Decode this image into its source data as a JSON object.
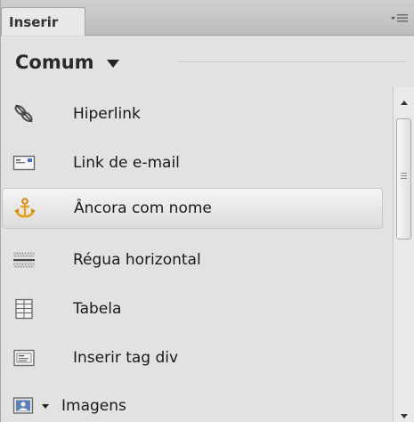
{
  "panel": {
    "tab_label": "Inserir",
    "menu_icon": "panel-options-icon"
  },
  "category": {
    "label": "Comum",
    "icon": "chevron-down-icon"
  },
  "items": [
    {
      "label": "Hiperlink",
      "icon": "hyperlink-icon"
    },
    {
      "label": "Link de e-mail",
      "icon": "email-link-icon"
    },
    {
      "label": "Âncora com nome",
      "icon": "named-anchor-icon",
      "selected": true
    },
    {
      "label": "Régua horizontal",
      "icon": "horizontal-rule-icon"
    },
    {
      "label": "Tabela",
      "icon": "table-icon"
    },
    {
      "label": "Inserir tag div",
      "icon": "div-tag-icon"
    },
    {
      "label": "Imagens",
      "icon": "image-icon"
    }
  ],
  "colors": {
    "panel_bg": "#e2e2e2",
    "tab_bg": "#e8e8e8",
    "anchor_icon": "#e3a21a"
  }
}
